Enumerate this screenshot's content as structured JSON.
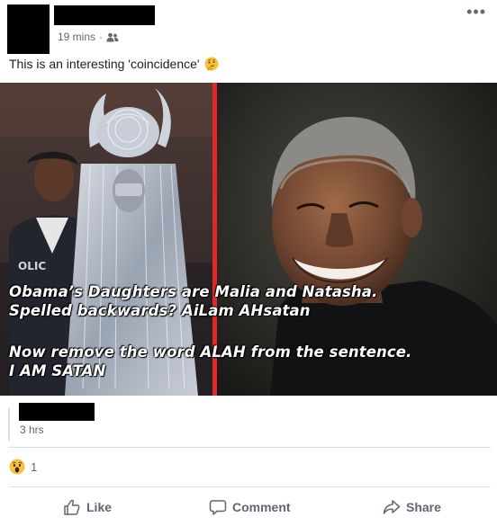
{
  "post": {
    "time": "19 mins",
    "separator": "·",
    "audience_icon": "friends-icon",
    "text": "This is an interesting 'coincidence'",
    "text_emoji": "thinking-face-emoji",
    "more_label": "•••"
  },
  "image": {
    "caption_line1": "Obama’s Daughters are Malia and Natasha.",
    "caption_line2": "Spelled backwards? AiLam AHsatan",
    "caption_line3": "Now remove the word ALAH from the sentence.",
    "caption_line4": "I AM SATAN",
    "shirt_text": "OLIC",
    "divider_color": "#e0282a"
  },
  "comment": {
    "time": "3 hrs"
  },
  "reactions": {
    "icon": "wow-emoji",
    "count": "1"
  },
  "actions": {
    "like": "Like",
    "comment": "Comment",
    "share": "Share"
  },
  "colors": {
    "secondary_text": "#606770",
    "divider": "#dadde1"
  }
}
